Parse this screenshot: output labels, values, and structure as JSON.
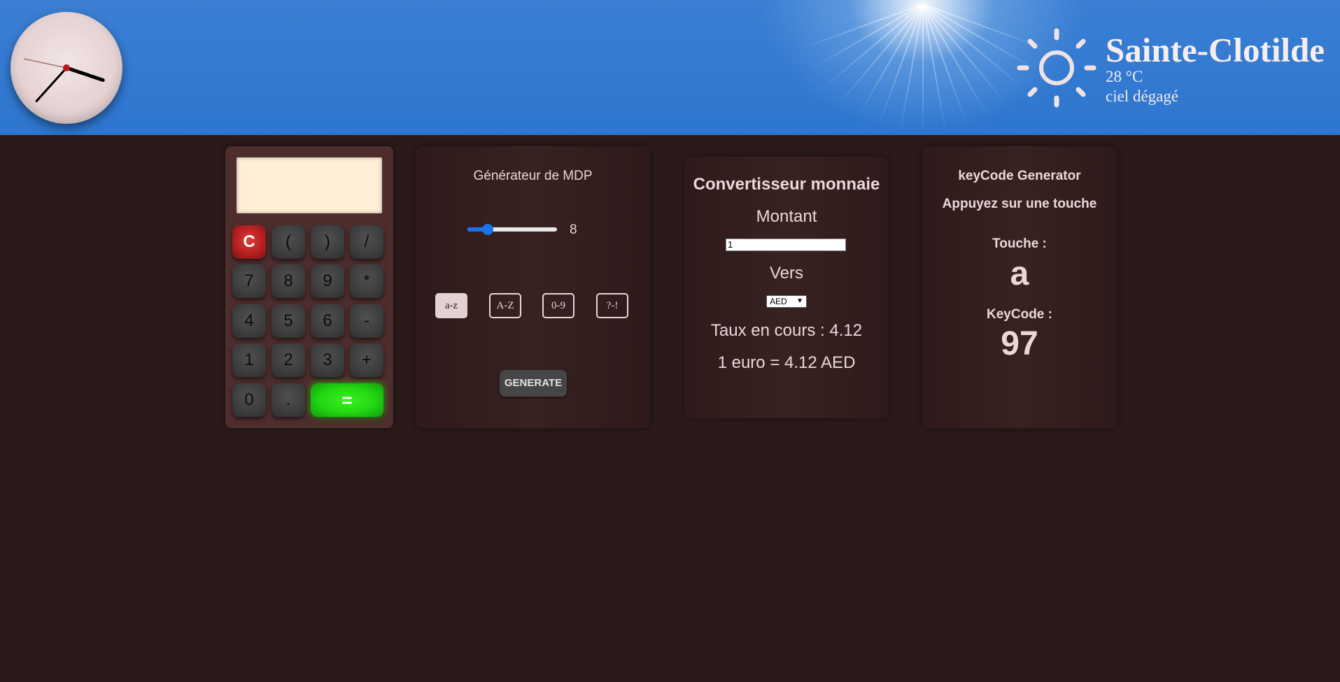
{
  "header": {
    "clock": {
      "hour": 3,
      "minute": 37,
      "second": 47
    },
    "weather": {
      "icon": "sun-icon",
      "city": "Sainte-Clotilde",
      "temperature": "28 °C",
      "description": "ciel dégagé"
    }
  },
  "calculator": {
    "display": "",
    "keys": [
      {
        "label": "C",
        "name": "clear-key"
      },
      {
        "label": "(",
        "name": "open-paren-key"
      },
      {
        "label": ")",
        "name": "close-paren-key"
      },
      {
        "label": "/",
        "name": "divide-key"
      },
      {
        "label": "7",
        "name": "seven-key"
      },
      {
        "label": "8",
        "name": "eight-key"
      },
      {
        "label": "9",
        "name": "nine-key"
      },
      {
        "label": "*",
        "name": "multiply-key"
      },
      {
        "label": "4",
        "name": "four-key"
      },
      {
        "label": "5",
        "name": "five-key"
      },
      {
        "label": "6",
        "name": "six-key"
      },
      {
        "label": "-",
        "name": "minus-key"
      },
      {
        "label": "1",
        "name": "one-key"
      },
      {
        "label": "2",
        "name": "two-key"
      },
      {
        "label": "3",
        "name": "three-key"
      },
      {
        "label": "+",
        "name": "plus-key"
      },
      {
        "label": "0",
        "name": "zero-key"
      },
      {
        "label": ".",
        "name": "decimal-key"
      },
      {
        "label": "=",
        "name": "equals-key"
      }
    ]
  },
  "password_generator": {
    "title": "Générateur de MDP",
    "length": "8",
    "length_fraction": 0.23,
    "options": [
      {
        "label": "a-z",
        "active": true
      },
      {
        "label": "A-Z",
        "active": false
      },
      {
        "label": "0-9",
        "active": false
      },
      {
        "label": "?-!",
        "active": false
      }
    ],
    "generate_label": "GENERATE"
  },
  "converter": {
    "title": "Convertisseur monnaie",
    "amount_label": "Montant",
    "amount_value": "1",
    "to_label": "Vers",
    "currency": "AED",
    "rate_text": "Taux en cours : 4.12",
    "result_text": "1 euro = 4.12 AED"
  },
  "keycode": {
    "title": "keyCode Generator",
    "subtitle": "Appuyez sur une touche",
    "key_label": "Touche :",
    "key_value": "a",
    "code_label": "KeyCode :",
    "code_value": "97"
  }
}
